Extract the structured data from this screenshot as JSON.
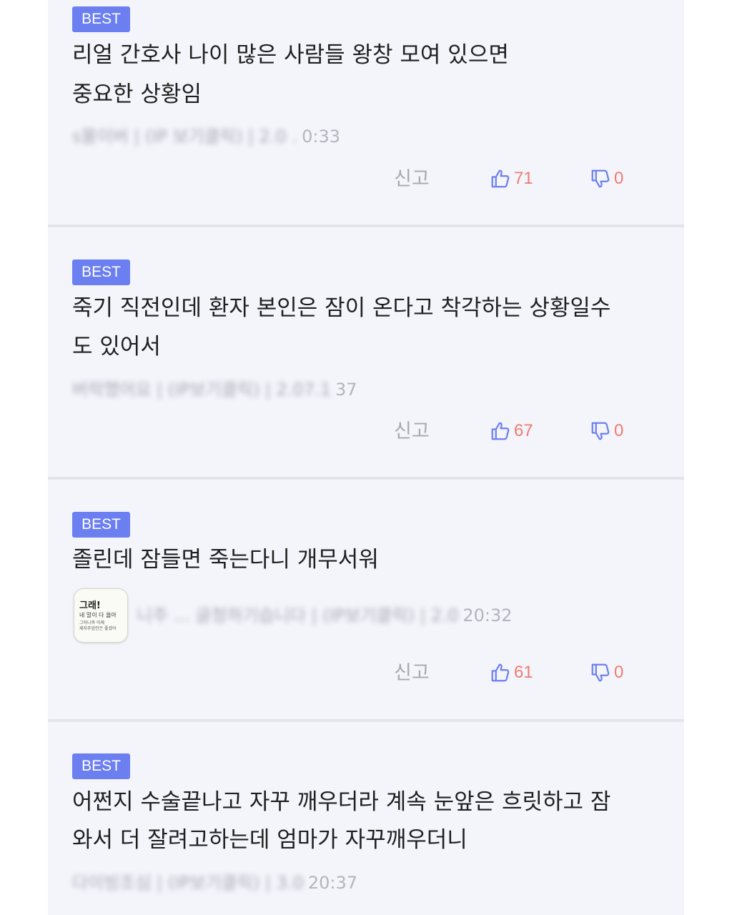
{
  "comments": [
    {
      "badge": "BEST",
      "lines": [
        "리얼 간호사 나이 많은 사람들 왕창 모여 있으면",
        "중요한 상황임"
      ],
      "meta_blurred": "s물이버 | (IP 보기클릭) | 2.0 .",
      "meta_time": "0:33",
      "report": "신고",
      "likes": "71",
      "dislikes": "0"
    },
    {
      "badge": "BEST",
      "lines": [
        "죽기 직전인데 환자 본인은 잠이 온다고 착각하는 상황일수",
        "도 있어서"
      ],
      "meta_blurred": "버락했어요 | (IP보기클릭) | 2.07.1",
      "meta_time": "37",
      "report": "신고",
      "likes": "67",
      "dislikes": "0"
    },
    {
      "badge": "BEST",
      "lines": [
        "졸린데 잠들면 죽는다니 개무서워"
      ],
      "avatar": {
        "line1": "그래!",
        "line2": "네 말이 다 옳아",
        "line3": "그러니까 이제",
        "line4": "제자주엄인은 좋겠어"
      },
      "meta_blurred": "니주 ... 글청하기습니다 | (IP보기클릭) | 2.0",
      "meta_time": "20:32",
      "report": "신고",
      "likes": "61",
      "dislikes": "0"
    },
    {
      "badge": "BEST",
      "lines": [
        "어쩐지 수술끝나고 자꾸 깨우더라 계속 눈앞은 흐릿하고 잠",
        "와서 더 잘려고하는데 엄마가 자꾸깨우더니"
      ],
      "meta_blurred": "다이빙조심 | (IP보기클릭) | 3.0",
      "meta_time": "20:37"
    }
  ],
  "colors": {
    "badge_bg": "#6c7ff1",
    "like_icon": "#6c7ff1",
    "count_text": "#f07a72",
    "panel_bg": "#f4f5fb"
  },
  "icons": {
    "like": "thumbs-up-icon",
    "dislike": "thumbs-down-icon"
  }
}
